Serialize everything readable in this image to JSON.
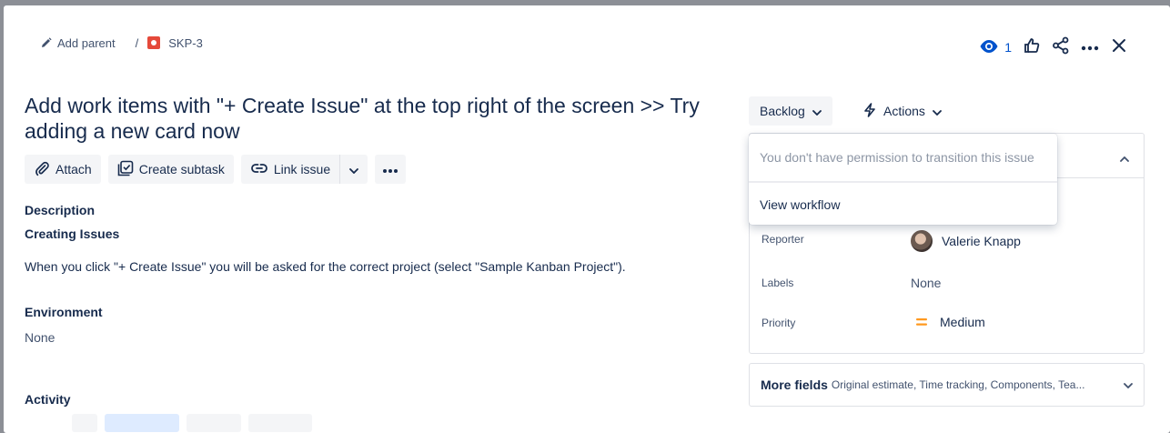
{
  "breadcrumb": {
    "add_parent": "Add parent",
    "separator": "/",
    "issue_key": "SKP-3"
  },
  "header": {
    "watch_count": "1"
  },
  "issue": {
    "title": "Add work items with \"+ Create Issue\" at the top right of the screen >> Try adding a new card now"
  },
  "toolbar": {
    "attach": "Attach",
    "create_subtask": "Create subtask",
    "link_issue": "Link issue"
  },
  "description": {
    "heading": "Description",
    "subheading": "Creating Issues",
    "text": "When you click \"+ Create Issue\" you will be asked for the correct project (select \"Sample Kanban Project\")."
  },
  "environment": {
    "heading": "Environment",
    "value": "None"
  },
  "activity": {
    "heading": "Activity"
  },
  "status": {
    "label": "Backlog",
    "actions_label": "Actions"
  },
  "dropdown": {
    "message": "You don't have permission to transition this issue",
    "view_workflow": "View workflow"
  },
  "details": {
    "reporter_label": "Reporter",
    "reporter_value": "Valerie Knapp",
    "labels_label": "Labels",
    "labels_value": "None",
    "priority_label": "Priority",
    "priority_value": "Medium"
  },
  "more_fields": {
    "label": "More fields",
    "summary": "Original estimate, Time tracking, Components, Tea..."
  },
  "colors": {
    "accent": "#0052cc",
    "priority_medium": "#ff991f",
    "issue_type_bug": "#e5493a"
  }
}
